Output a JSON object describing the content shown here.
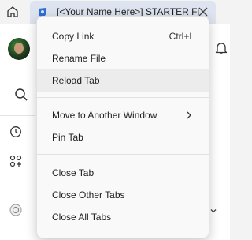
{
  "tab": {
    "title": "[<Your Name Here>] STARTER Fi"
  },
  "menu": {
    "copy_link": "Copy Link",
    "copy_link_shortcut": "Ctrl+L",
    "rename_file": "Rename File",
    "reload_tab": "Reload Tab",
    "move_window": "Move to Another Window",
    "pin_tab": "Pin Tab",
    "close_tab": "Close Tab",
    "close_other_tabs": "Close Other Tabs",
    "close_all_tabs": "Close All Tabs"
  },
  "icons": {
    "home": "home-icon",
    "favicon": "app-favicon-icon",
    "close": "close-icon",
    "search": "search-icon",
    "history": "history-icon",
    "apps": "apps-icon",
    "bell": "bell-icon",
    "submenu": "chevron-right-icon"
  },
  "colors": {
    "active_tab": "#dde4ef",
    "menu_bg": "#f9f9f9",
    "menu_hover": "#ececec"
  }
}
